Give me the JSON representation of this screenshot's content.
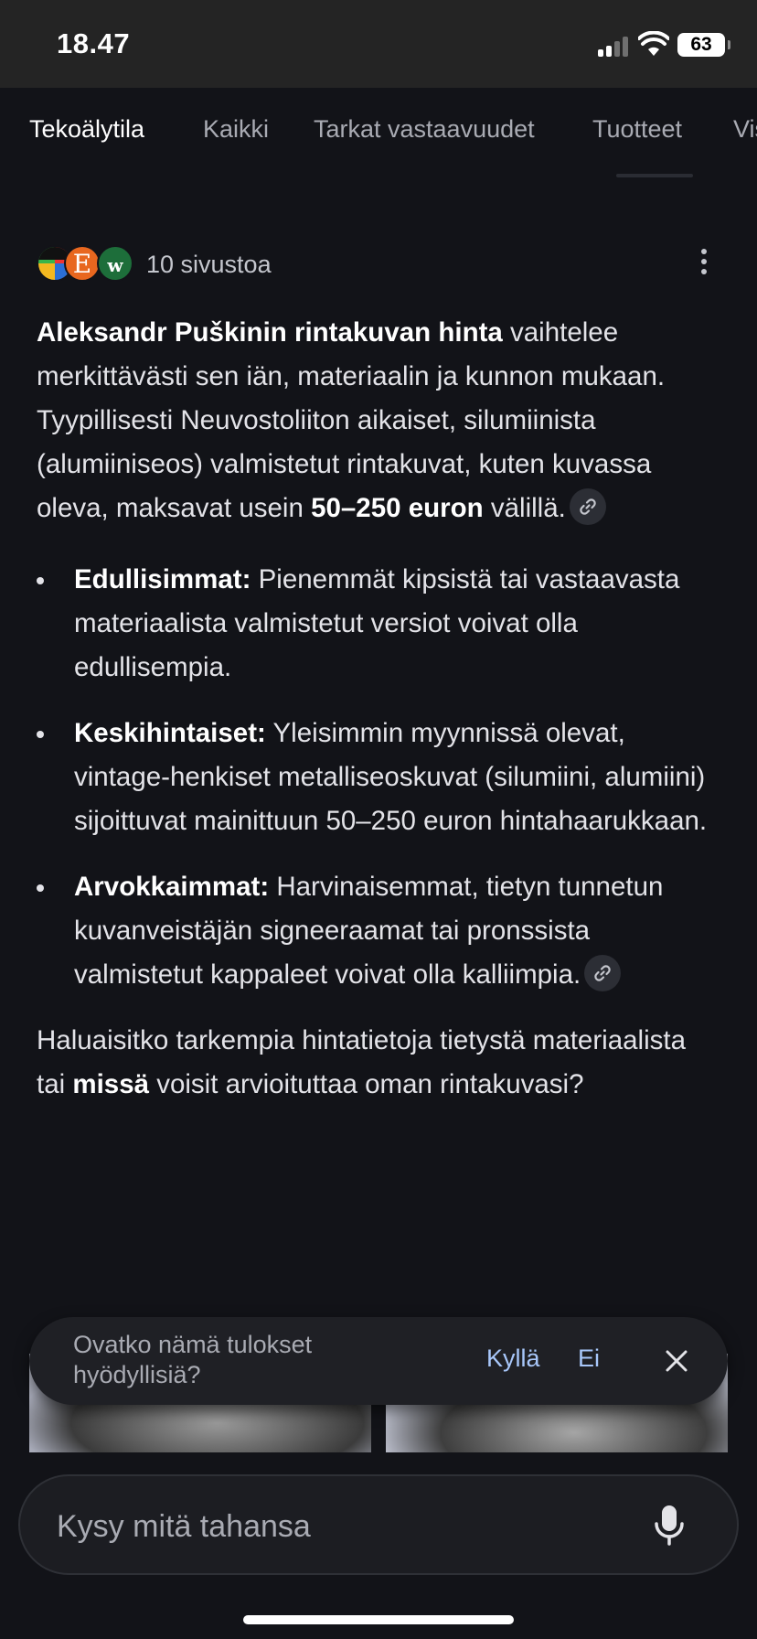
{
  "status_bar": {
    "time": "18.47",
    "battery": "63"
  },
  "tabs": [
    {
      "label": "Tekoälytila",
      "active": true
    },
    {
      "label": "Kaikki"
    },
    {
      "label": "Tarkat vastaavuudet"
    },
    {
      "label": "Tuotteet"
    },
    {
      "label": "Vis"
    }
  ],
  "sources": {
    "count_label": "10 sivustoa",
    "favicons": [
      "colorful-logo",
      "E",
      "w"
    ]
  },
  "answer": {
    "intro_bold": "Aleksandr Puškinin rintakuvan hinta",
    "intro_text": " vaihtelee merkittävästi sen iän, materiaalin ja kunnon mukaan. Tyypillisesti Neuvostoliiton aikaiset, silumiinista (alumiiniseos) valmistetut rintakuvat, kuten kuvassa oleva, maksavat usein ",
    "intro_price_bold": "50–250 euron",
    "intro_tail": " välillä.",
    "bullets": [
      {
        "term": "Edullisimmat:",
        "text": " Pienemmät kipsistä tai vastaavasta materiaalista valmistetut versiot voivat olla edullisempia."
      },
      {
        "term": "Keskihintaiset:",
        "text": " Yleisimmin myynnissä olevat, vintage-henkiset metalliseoskuvat (silumiini, alumiini) sijoittuvat mainittuun 50–250 euron hintahaarukkaan."
      },
      {
        "term": "Arvokkaimmat:",
        "text": " Harvinaisemmat, tietyn tunnetun kuvanveistäjän signeeraamat tai pronssista valmistetut kappaleet voivat olla kalliimpia."
      }
    ],
    "question_pre": "Haluaisitko tarkempia hintatietoja tietystä materiaalista tai ",
    "question_bold": "missä",
    "question_post": " voisit arvioituttaa oman rintakuvasi?"
  },
  "feedback": {
    "question": "Ovatko nämä tulokset hyödyllisiä?",
    "yes": "Kyllä",
    "no": "Ei"
  },
  "search": {
    "placeholder": "Kysy mitä tahansa"
  },
  "colors": {
    "background": "#121318",
    "accent_link": "#a8c7fa",
    "text": "#e3e3e8"
  }
}
